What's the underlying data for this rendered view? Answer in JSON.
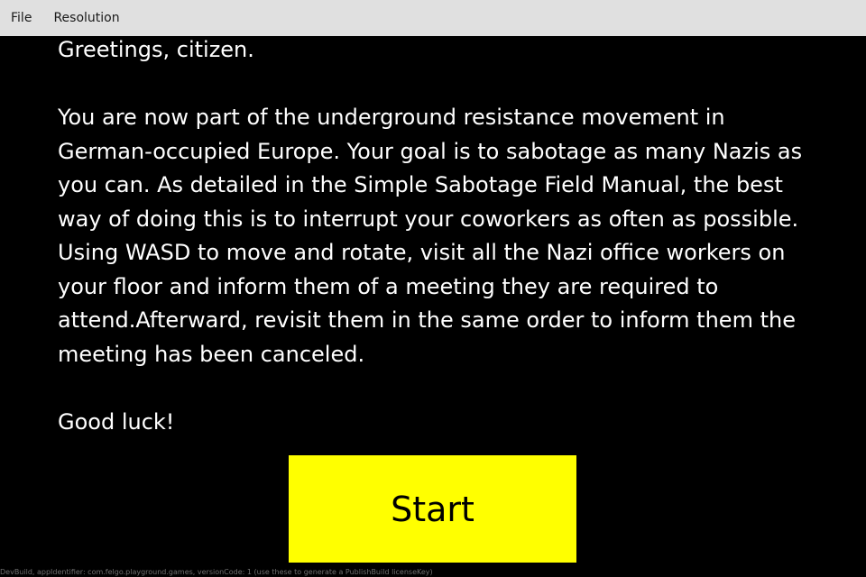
{
  "menubar": {
    "items": [
      {
        "label": "File"
      },
      {
        "label": "Resolution"
      }
    ]
  },
  "intro": {
    "greeting": "Greetings, citizen.",
    "body": "You are now part of the underground resistance movement in German-occupied Europe. Your goal is to sabotage as many Nazis as you can. As detailed in the Simple Sabotage Field Manual, the best way of doing this is to interrupt your coworkers as often as possible. Using WASD to move and rotate, visit all the Nazi office workers on your floor and inform them of a meeting they are required to attend.Afterward, revisit them in the same order to inform them the meeting has been canceled.",
    "closing": "Good luck!"
  },
  "start_button": {
    "label": "Start"
  },
  "footer": {
    "devbuild_text": "DevBuild, appIdentifier: com.felgo.playground.games, versionCode: 1 (use these to generate a PublishBuild licenseKey)"
  },
  "colors": {
    "background": "#000000",
    "text": "#ffffff",
    "button": "#ffff00",
    "menubar": "#e0e0e0"
  }
}
